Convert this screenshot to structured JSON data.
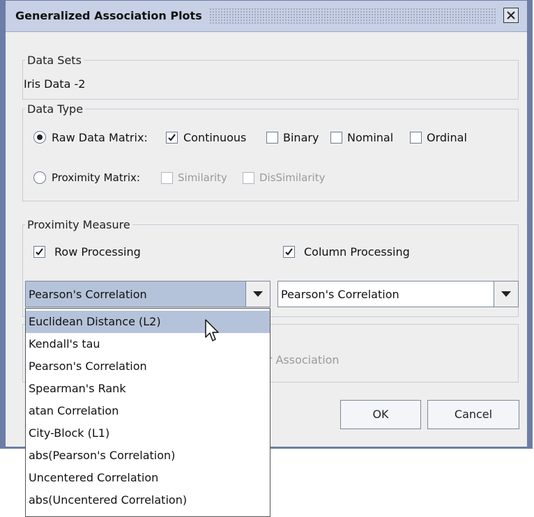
{
  "window": {
    "title": "Generalized Association Plots"
  },
  "data_sets": {
    "legend": "Data Sets",
    "value": "Iris Data -2"
  },
  "data_type": {
    "legend": "Data Type",
    "raw_label": "Raw Data Matrix:",
    "raw_selected": true,
    "raw_options": [
      {
        "label": "Continuous",
        "checked": true
      },
      {
        "label": "Binary",
        "checked": false
      },
      {
        "label": "Nominal",
        "checked": false
      },
      {
        "label": "Ordinal",
        "checked": false
      }
    ],
    "prox_label": "Proximity Matrix:",
    "prox_selected": false,
    "prox_options": [
      {
        "label": "Similarity",
        "checked": false,
        "enabled": false
      },
      {
        "label": "DisSimilarity",
        "checked": false,
        "enabled": false
      }
    ]
  },
  "proximity_measure": {
    "legend": "Proximity Measure",
    "row_label": "Row Processing",
    "row_checked": true,
    "col_label": "Column Processing",
    "col_checked": true,
    "row_value": "Pearson's Correlation",
    "col_value": "Pearson's Correlation"
  },
  "hidden_panel": {
    "partial_text": "ar Association"
  },
  "buttons": {
    "ok": "OK",
    "cancel": "Cancel"
  },
  "dropdown": {
    "items": [
      "Euclidean Distance (L2)",
      "Kendall's tau",
      "Pearson's Correlation",
      "Spearman's Rank",
      "atan Correlation",
      "City-Block (L1)",
      "abs(Pearson's Correlation)",
      "Uncentered Correlation",
      "abs(Uncentered Correlation)"
    ],
    "highlighted": "Euclidean Distance (L2)"
  },
  "icons": {
    "close": "close-icon",
    "checkmark": "checkmark-icon",
    "arrow": "chevron-down-icon",
    "cursor": "mouse-pointer-icon"
  },
  "colors": {
    "window_frame": "#6c7da6",
    "title_bar": "#c7d0e4",
    "selection": "#b5c3da",
    "panel": "#eeeeee"
  }
}
